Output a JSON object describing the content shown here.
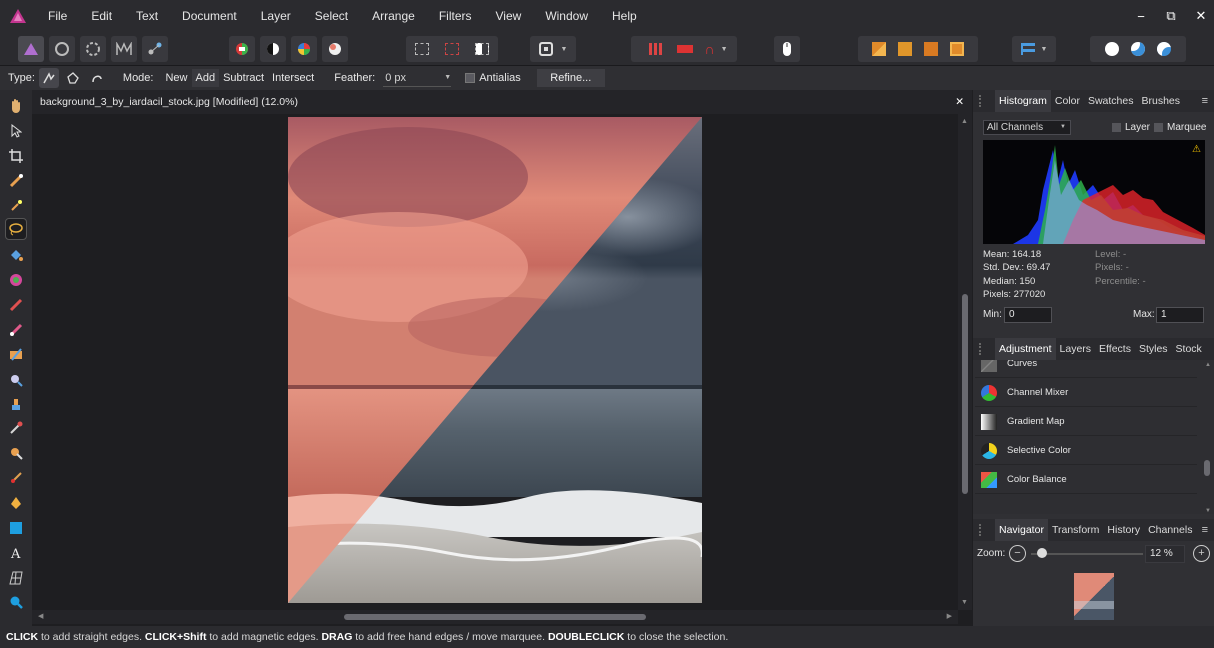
{
  "menu": [
    "File",
    "Edit",
    "Text",
    "Document",
    "Layer",
    "Select",
    "Arrange",
    "Filters",
    "View",
    "Window",
    "Help"
  ],
  "window_controls": {
    "minimize": "−",
    "restore": "⧉",
    "close": "✕"
  },
  "context": {
    "type_label": "Type:",
    "mode_label": "Mode:",
    "modes": [
      "New",
      "Add",
      "Subtract",
      "Intersect"
    ],
    "selected_mode": "Add",
    "feather_label": "Feather:",
    "feather_value": "0 px",
    "antialias_label": "Antialias",
    "refine_label": "Refine..."
  },
  "document": {
    "title": "background_3_by_iardacil_stock.jpg [Modified] (12.0%)",
    "close": "✕"
  },
  "histogram_panel": {
    "tabs": [
      "Histogram",
      "Color",
      "Swatches",
      "Brushes"
    ],
    "active_tab": "Histogram",
    "channels": "All Channels",
    "layer_label": "Layer",
    "marquee_label": "Marquee",
    "mean": "Mean: 164.18",
    "std_dev": "Std. Dev.: 69.47",
    "median": "Median: 150",
    "pixels": "Pixels: 277020",
    "level": "Level: -",
    "pixels_sel": "Pixels: -",
    "percentile": "Percentile: -",
    "min_label": "Min:",
    "min_value": "0",
    "max_label": "Max:",
    "max_value": "1"
  },
  "adjustment_panel": {
    "tabs": [
      "Adjustment",
      "Layers",
      "Effects",
      "Styles",
      "Stock"
    ],
    "active_tab": "Adjustment",
    "items": [
      "Curves",
      "Channel Mixer",
      "Gradient Map",
      "Selective Color",
      "Color Balance"
    ]
  },
  "navigator_panel": {
    "tabs": [
      "Navigator",
      "Transform",
      "History",
      "Channels"
    ],
    "active_tab": "Navigator",
    "zoom_label": "Zoom:",
    "zoom_value": "12 %",
    "zoom_level": 0.12
  },
  "status": {
    "k1": "CLICK",
    "t1": " to add straight edges. ",
    "k2": "CLICK+Shift",
    "t2": " to add magnetic edges. ",
    "k3": "DRAG",
    "t3": " to add free hand edges / move marquee. ",
    "k4": "DOUBLECLICK",
    "t4": " to close the selection."
  },
  "colors": {
    "accent": "#3c7fc4",
    "warning": "#f2c200",
    "selection": "#e5775f"
  }
}
